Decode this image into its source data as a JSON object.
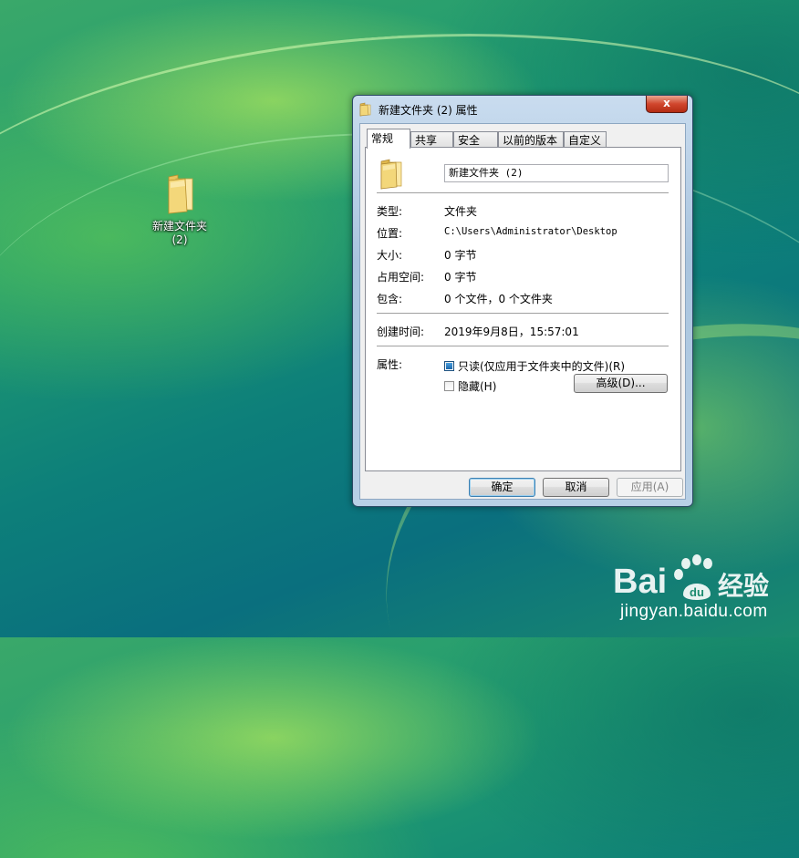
{
  "desktop": {
    "icon_label": "新建文件夹\n(2)"
  },
  "dialog": {
    "title": "新建文件夹 (2) 属性",
    "close_label": "x",
    "tabs": [
      "常规",
      "共享",
      "安全",
      "以前的版本",
      "自定义"
    ],
    "active_tab": "常规",
    "general": {
      "name_value": "新建文件夹 (2)",
      "rows": [
        {
          "label": "类型:",
          "value": "文件夹"
        },
        {
          "label": "位置:",
          "value": "C:\\Users\\Administrator\\Desktop"
        },
        {
          "label": "大小:",
          "value": "0 字节"
        },
        {
          "label": "占用空间:",
          "value": "0 字节"
        },
        {
          "label": "包含:",
          "value": "0 个文件，0 个文件夹"
        }
      ],
      "created_label": "创建时间:",
      "created_value": "2019年9月8日，15:57:01",
      "attributes_label": "属性:",
      "readonly_label": "只读(仅应用于文件夹中的文件)(R)",
      "readonly_state": "indeterminate",
      "hidden_label": "隐藏(H)",
      "hidden_state": "unchecked",
      "advanced_label": "高级(D)..."
    },
    "buttons": {
      "ok": "确定",
      "cancel": "取消",
      "apply": "应用(A)"
    }
  },
  "watermark": {
    "logo_text": "Bai 经验",
    "url": "jingyan.baidu.com"
  },
  "colors": {
    "folder": "#f3d77a",
    "title_close": "#c8432b",
    "checkbox_fill": "#1b65a8"
  }
}
